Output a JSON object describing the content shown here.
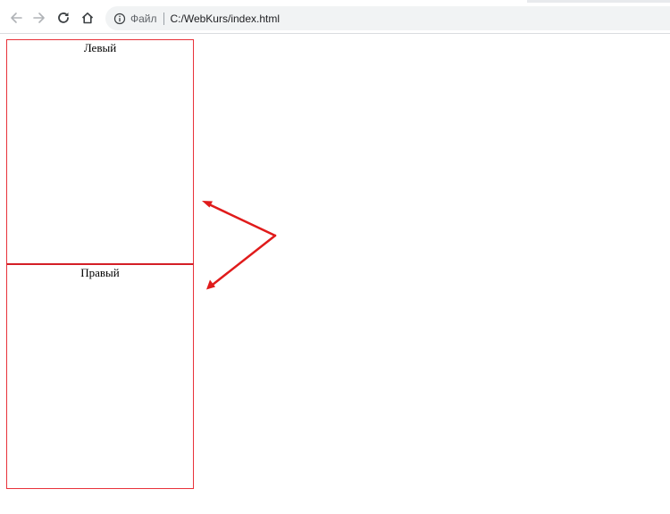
{
  "browser": {
    "nav": {
      "back_icon": "arrow-left-icon",
      "forward_icon": "arrow-right-icon",
      "reload_icon": "reload-icon",
      "home_icon": "home-icon"
    },
    "omnibox": {
      "info_icon": "info-icon",
      "scheme_label": "Файл",
      "url": "C:/WebKurs/index.html"
    }
  },
  "page": {
    "left_block_label": "Левый",
    "right_block_label": "Правый",
    "border_color": "#e8323a",
    "annotation_color": "#e01b1b"
  }
}
